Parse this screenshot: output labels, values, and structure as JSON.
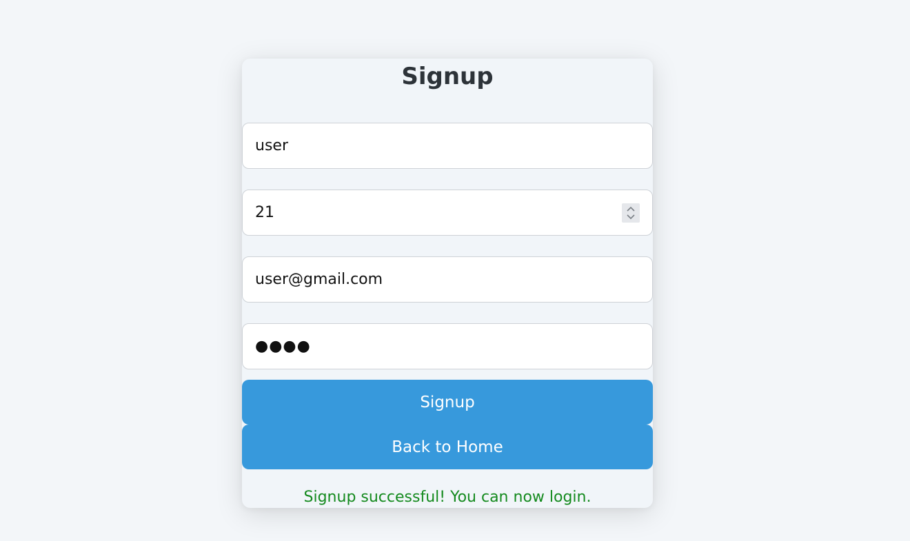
{
  "form": {
    "title": "Signup",
    "username_value": "user",
    "age_value": "21",
    "email_value": "user@gmail.com",
    "password_display": "●●●●",
    "signup_label": "Signup",
    "back_label": "Back to Home",
    "success_message": "Signup successful! You can now login."
  },
  "colors": {
    "page_background": "#f3f6f9",
    "card_background": "#f1f5f9",
    "button_background": "#3799dc",
    "success_text": "#148a1e"
  },
  "icons": {
    "stepper": "chevron-up-down-icon"
  }
}
